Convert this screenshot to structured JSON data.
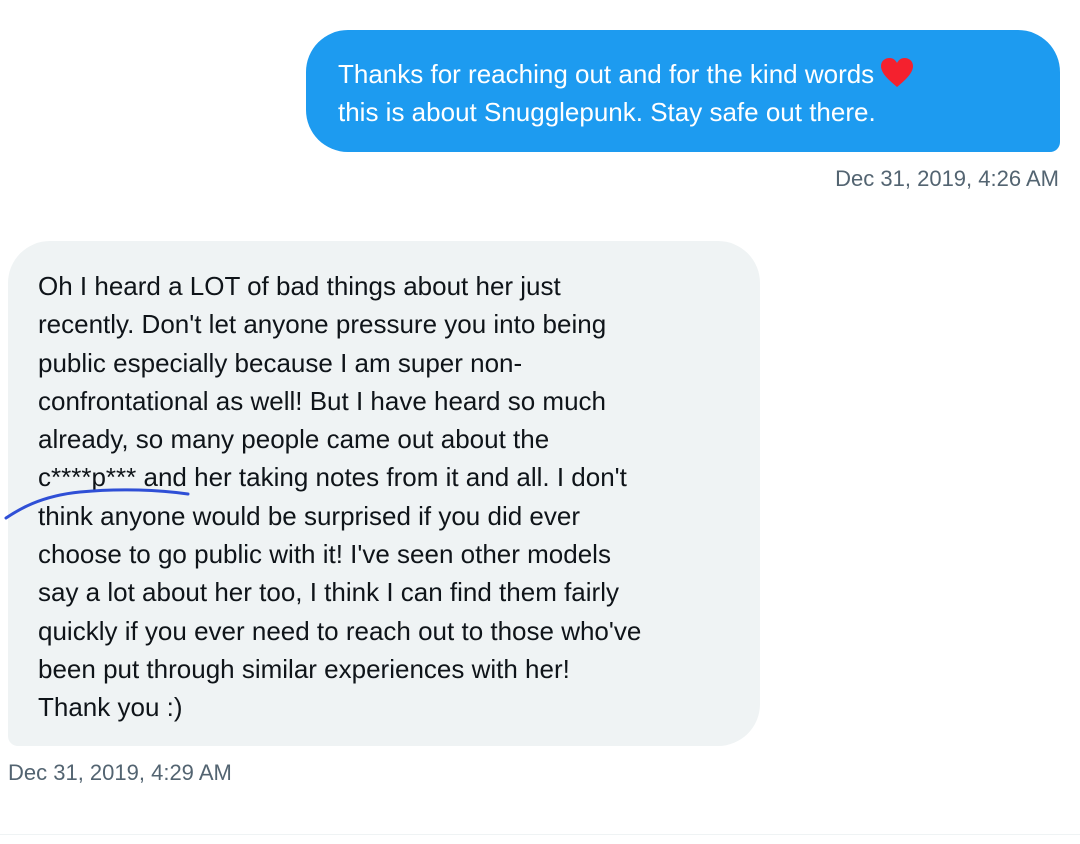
{
  "colors": {
    "sent_bubble": "#1d9bf0",
    "received_bubble": "#eff3f4",
    "timestamp": "#536471",
    "heart": "#f4212e",
    "scribble": "#2f4fd6"
  },
  "messages": [
    {
      "direction": "sent",
      "lines": [
        "Thanks for reaching out and for the kind words",
        "this is about Snugglepunk.  Stay safe out there."
      ],
      "emoji": "red-heart-icon",
      "timestamp": "Dec 31, 2019, 4:26 AM"
    },
    {
      "direction": "received",
      "lines": [
        "Oh I heard a LOT of bad things about her just",
        "recently. Don't let anyone pressure you into being",
        "public especially because I am super non-",
        "confrontational as well! But I have heard so much",
        "already, so many people came out about the",
        "c****p*** and her taking notes from it and all. I don't",
        "think anyone would be surprised if you did ever",
        "choose to go public with it! I've seen other models",
        "say a lot about her too, I think I can find them fairly",
        "quickly if you ever need to reach out to those who've",
        "been put through similar experiences with her!",
        "Thank you :)"
      ],
      "annotation": "hand-drawn-underline-scribble",
      "timestamp": "Dec 31, 2019, 4:29 AM"
    }
  ]
}
